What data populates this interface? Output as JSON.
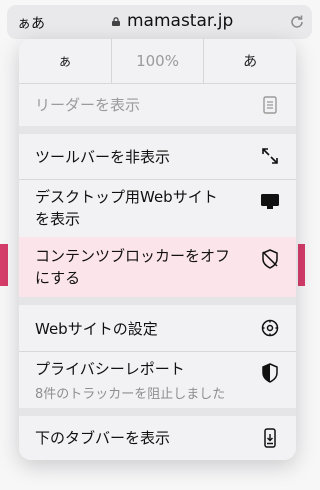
{
  "browser": {
    "aa_label": "ぁあ",
    "domain": "mamastar.jp"
  },
  "menu": {
    "zoom": {
      "smaller": "ぁ",
      "percent": "100%",
      "larger": "あ"
    },
    "items": [
      {
        "label": "リーダーを表示",
        "icon": "reader-icon",
        "disabled": true
      },
      {
        "label": "ツールバーを非表示",
        "icon": "expand-arrows-icon"
      },
      {
        "label": "デスクトップ用Webサイト\nを表示",
        "icon": "desktop-icon"
      },
      {
        "label": "コンテンツブロッカーをオフ\nにする",
        "icon": "shield-off-icon",
        "highlighted": true
      },
      {
        "label": "Webサイトの設定",
        "icon": "gear-icon"
      },
      {
        "label": "プライバシーレポート",
        "sublabel": "8件のトラッカーを阻止しました",
        "icon": "privacy-shield-icon"
      },
      {
        "label": "下のタブバーを表示",
        "icon": "phone-tabbar-icon"
      }
    ]
  }
}
